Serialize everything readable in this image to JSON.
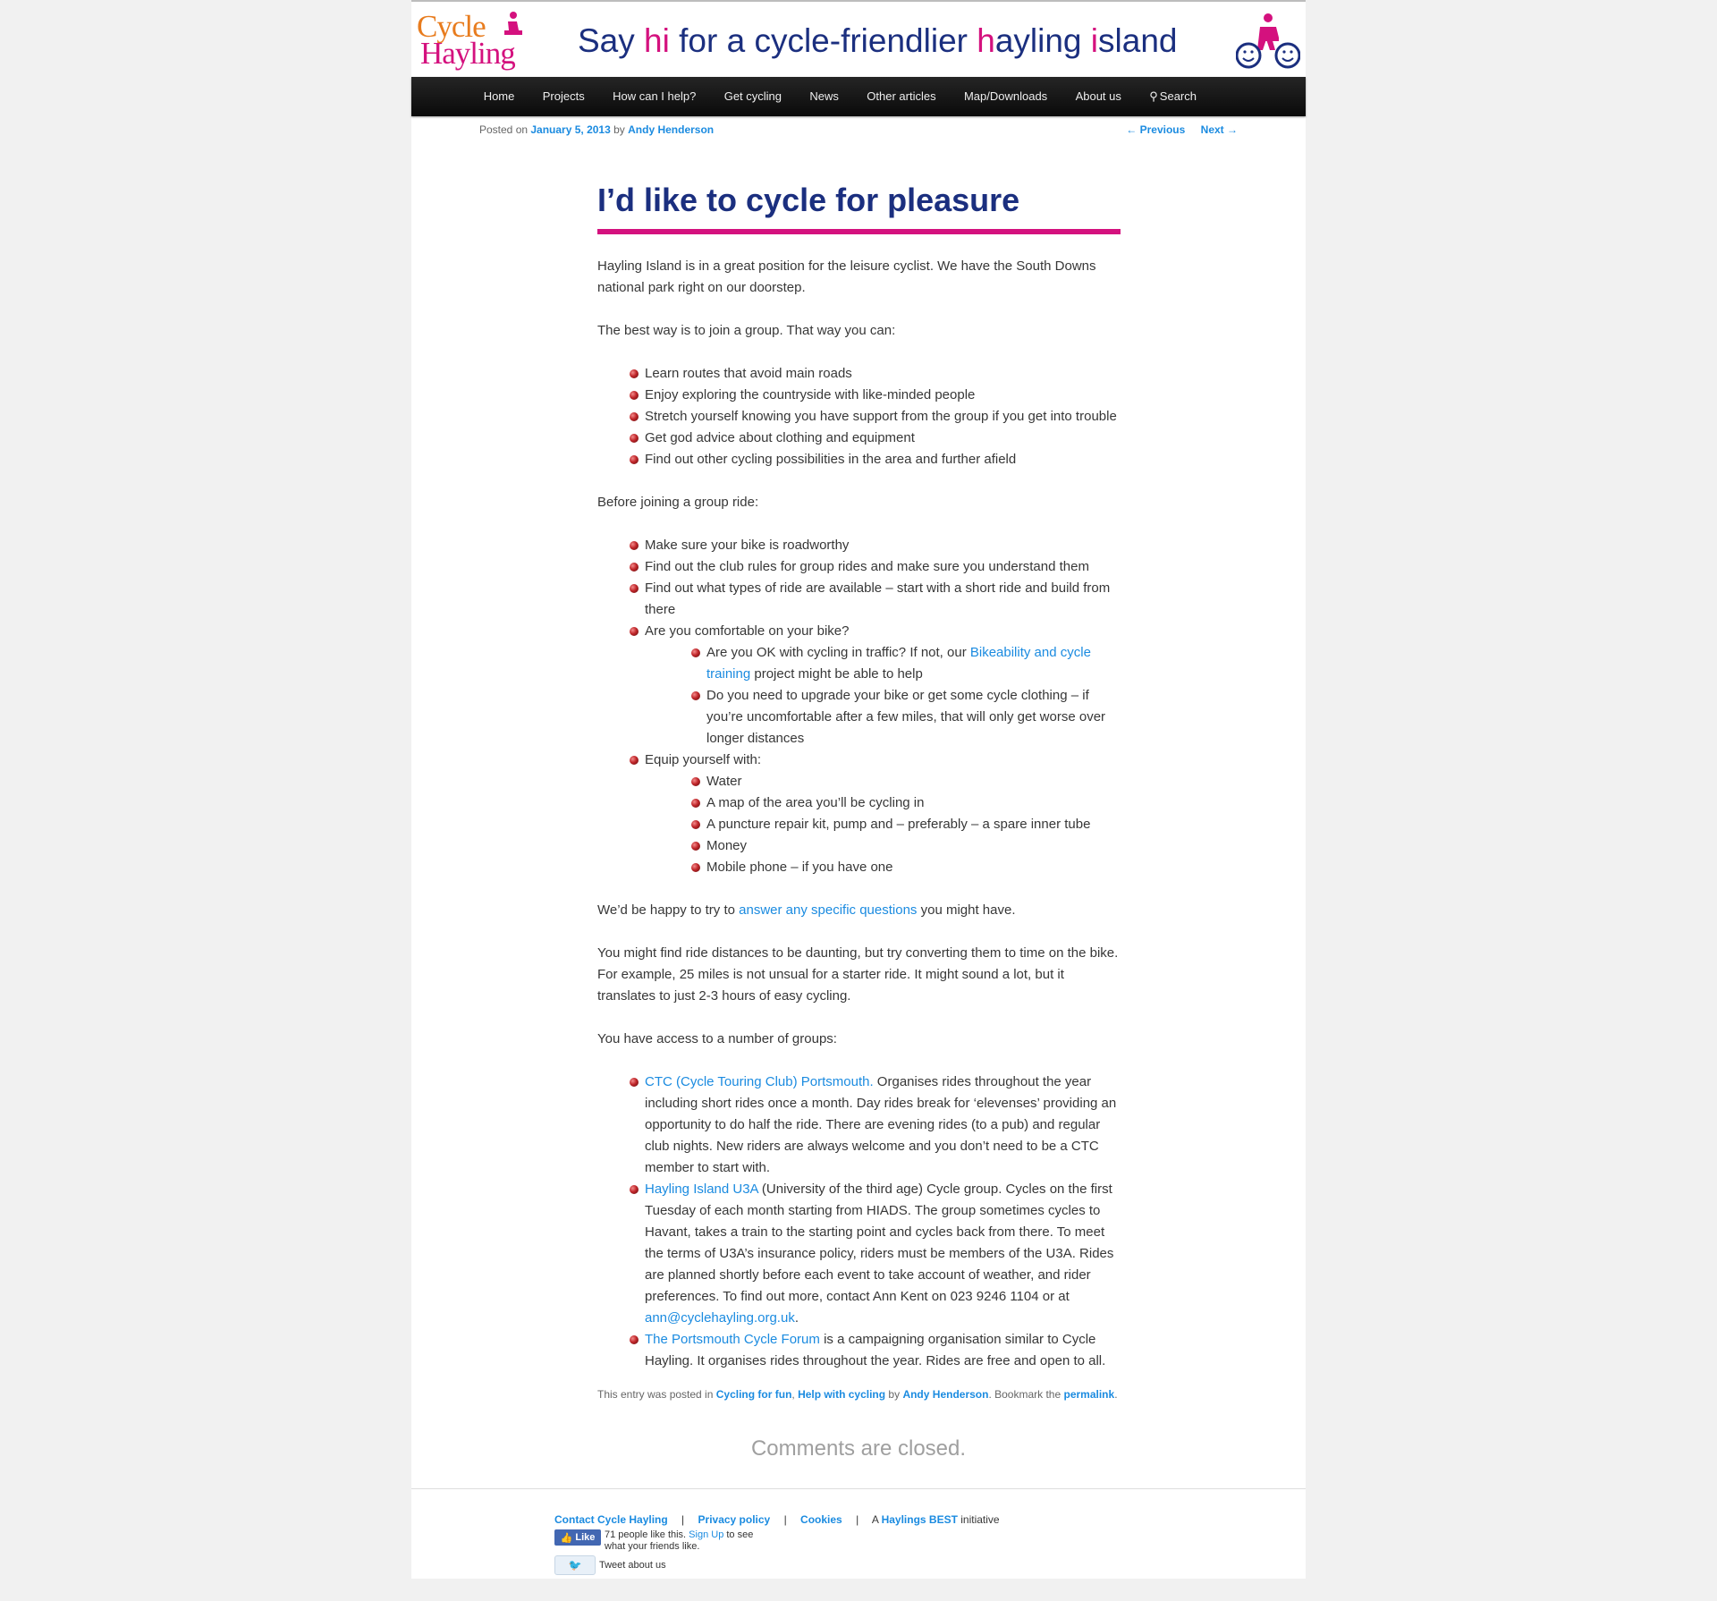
{
  "logo": {
    "line1": "Cycle",
    "line2": "Hayling"
  },
  "tagline": {
    "p1": "Say ",
    "h1": "hi",
    "p2": " for a cycle-friendlier ",
    "h2": "h",
    "p3": "ayling ",
    "h3": "i",
    "p4": "sland"
  },
  "nav": {
    "home": "Home",
    "projects": "Projects",
    "help": "How can I help?",
    "get_cycling": "Get cycling",
    "news": "News",
    "other": "Other articles",
    "map": "Map/Downloads",
    "about": "About us",
    "search": "Search"
  },
  "meta": {
    "posted_on": "Posted on ",
    "date": "January 5, 2013",
    "by": " by ",
    "author": "Andy Henderson"
  },
  "post_nav": {
    "previous": "← Previous",
    "next": "Next →"
  },
  "title": "I’d like to cycle for pleasure",
  "content": {
    "intro": "Hayling Island is in a great position for the leisure cyclist.  We have the South Downs national park right on our doorstep.",
    "best_way": "The best way is to join a group.  That way you can:",
    "benefits": [
      "Learn routes that avoid main roads",
      "Enjoy exploring the countryside with like-minded people",
      "Stretch yourself knowing you have support from the group if you get into trouble",
      "Get god advice about clothing and equipment",
      "Find out other cycling possibilities in the area and further afield"
    ],
    "before": "Before joining a group ride:",
    "before_items": {
      "i1": "Make sure your bike is roadworthy",
      "i2": "Find out the club rules for group rides and make sure you understand them",
      "i3": "Find out what types of ride are available – start with a short ride and build from there",
      "i4": "Are you comfortable on your bike?",
      "i4a_pre": "Are you OK with cycling in traffic?  If not, our ",
      "i4a_link": "Bikeability and cycle training",
      "i4a_post": " project might be able to help",
      "i4b": "Do you need to upgrade your bike or get some cycle clothing – if you’re uncomfortable after a few miles, that will only get worse over longer distances",
      "i5": "Equip yourself with:",
      "equip": [
        "Water",
        "A map of the area you’ll be cycling in",
        "A puncture repair kit, pump and – preferably – a spare inner tube",
        "Money",
        "Mobile phone – if you have one"
      ]
    },
    "happy_pre": "We’d be happy to try to ",
    "happy_link": "answer any specific questions",
    "happy_post": " you might have.",
    "distances": "You might find ride distances to be daunting, but try converting them to time on the bike.  For example, 25 miles is not unsual for a starter ride.  It might sound a lot, but it translates to just 2-3 hours of easy cycling.",
    "groups_intro": "You have access to a number of groups:",
    "ctc_link": "CTC (Cycle Touring Club) Portsmouth.",
    "ctc_text": "  Organises rides throughout the year including short rides once a month.  Day rides break for ‘elevenses’ providing an opportunity to do half the ride.  There are evening rides (to a pub) and regular club nights.  New riders are always welcome and you don’t need to be a CTC member to start with.",
    "u3a_link": "Hayling Island U3A",
    "u3a_text": " (University of the third age) Cycle group.  Cycles on the first Tuesday of each month starting from HIADS.  The group sometimes cycles to Havant, takes a train to the starting point and cycles back from there.  To meet the terms of U3A’s insurance policy, riders must be members of the U3A.  Rides are planned shortly before each event to take account of weather, and rider preferences.  To find out more, contact Ann Kent on 023 9246 1104 or at ",
    "u3a_email": "ann@cyclehayling.org.uk",
    "u3a_end": ".",
    "pcf_link": "The Portsmouth Cycle Forum",
    "pcf_text": " is a campaigning organisation similar to Cycle Hayling.  It organises rides throughout the year.  Rides are free and open to all."
  },
  "entry_footer": {
    "pre": "This entry was posted in ",
    "cat1": "Cycling for fun",
    "comma": ", ",
    "cat2": "Help with cycling",
    "by": " by ",
    "author": "Andy Henderson",
    "bookmark": ". Bookmark the ",
    "permalink": "permalink",
    "end": "."
  },
  "comments_closed": "Comments are closed.",
  "footer": {
    "contact": "Contact Cycle Hayling",
    "privacy": "Privacy policy",
    "cookies": "Cookies",
    "a": "A ",
    "best": "Haylings BEST",
    "initiative": " initiative",
    "sep": "|"
  },
  "facebook": {
    "like": "Like",
    "text_pre": "71 people like this. ",
    "signup": "Sign Up",
    "text_post": " to see what your friends like."
  },
  "twitter": {
    "text": "Tweet about us"
  },
  "colors": {
    "brand_blue": "#1b2f7f",
    "brand_pink": "#d4117e",
    "brand_orange": "#e87c1e",
    "link": "#1b8be0"
  }
}
